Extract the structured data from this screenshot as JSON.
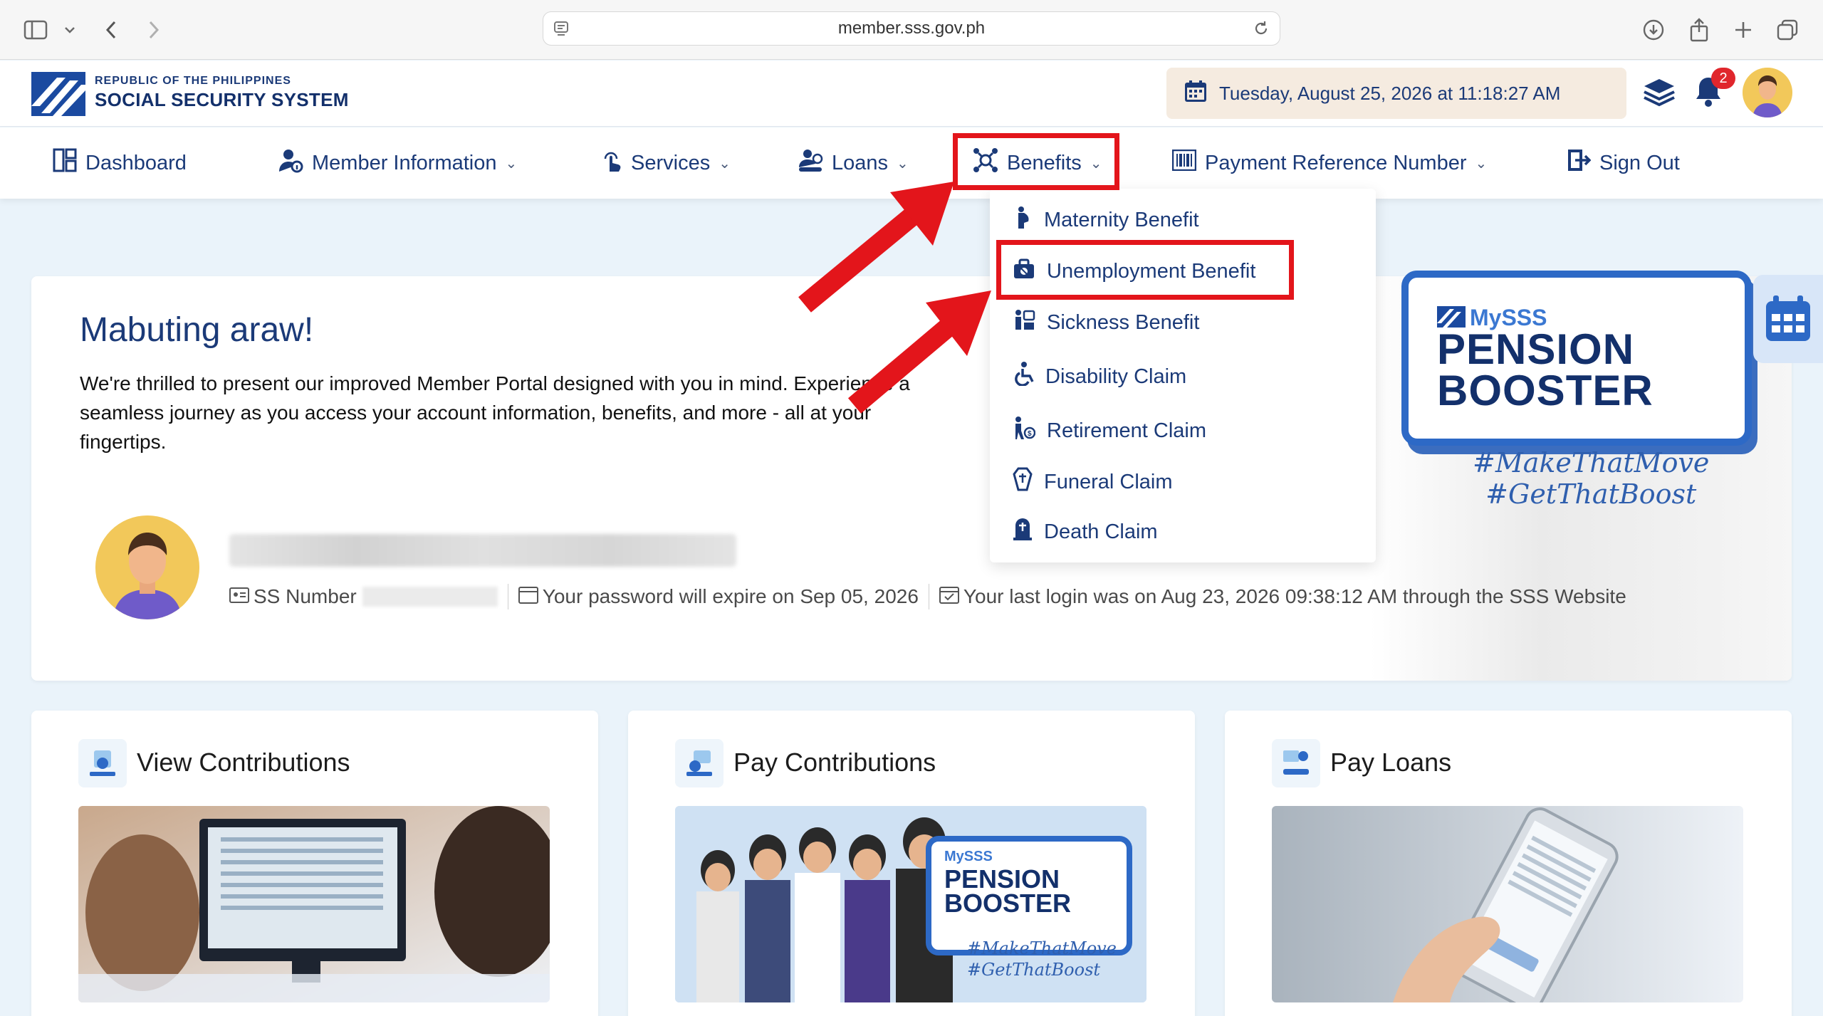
{
  "browser": {
    "url": "member.sss.gov.ph"
  },
  "header": {
    "agency_small": "REPUBLIC OF THE PHILIPPINES",
    "agency_name": "SOCIAL SECURITY SYSTEM",
    "datetime": "Tuesday, August 25, 2026 at 11:18:27 AM",
    "notification_count": "2"
  },
  "nav": {
    "dashboard": "Dashboard",
    "member_information": "Member Information",
    "services": "Services",
    "loans": "Loans",
    "benefits": "Benefits",
    "prn": "Payment Reference Number",
    "sign_out": "Sign Out"
  },
  "benefits_menu": {
    "maternity": "Maternity Benefit",
    "unemployment": "Unemployment Benefit",
    "sickness": "Sickness Benefit",
    "disability": "Disability Claim",
    "retirement": "Retirement Claim",
    "funeral": "Funeral Claim",
    "death": "Death Claim"
  },
  "welcome": {
    "greeting": "Mabuting araw!",
    "intro": "We're thrilled to present our improved Member Portal designed with you in mind. Experience a seamless journey as you access your account information, benefits, and more - all at your fingertips.",
    "ss_label": "SS Number",
    "password_expiry": "Your password will expire on Sep 05, 2026",
    "last_login": "Your last login was on Aug 23, 2026 09:38:12 AM through the SSS Website"
  },
  "banner": {
    "brand": "MySSS",
    "title_line1": "PENSION",
    "title_line2": "BOOSTER",
    "hashtag1": "#MakeThatMove",
    "hashtag2": "#GetThatBoost"
  },
  "cards": {
    "view_contributions": "View Contributions",
    "pay_contributions": "Pay Contributions",
    "pay_loans": "Pay Loans"
  },
  "pay_contrib_image": {
    "brand": "MySSS",
    "title_line1": "PENSION",
    "title_line2": "BOOSTER",
    "hashtag1": "#MakeThatMove",
    "hashtag2": "#GetThatBoost"
  },
  "colors": {
    "accent": "#1b3a78",
    "highlight": "#e3151b",
    "page_bg": "#eaf3fa"
  }
}
